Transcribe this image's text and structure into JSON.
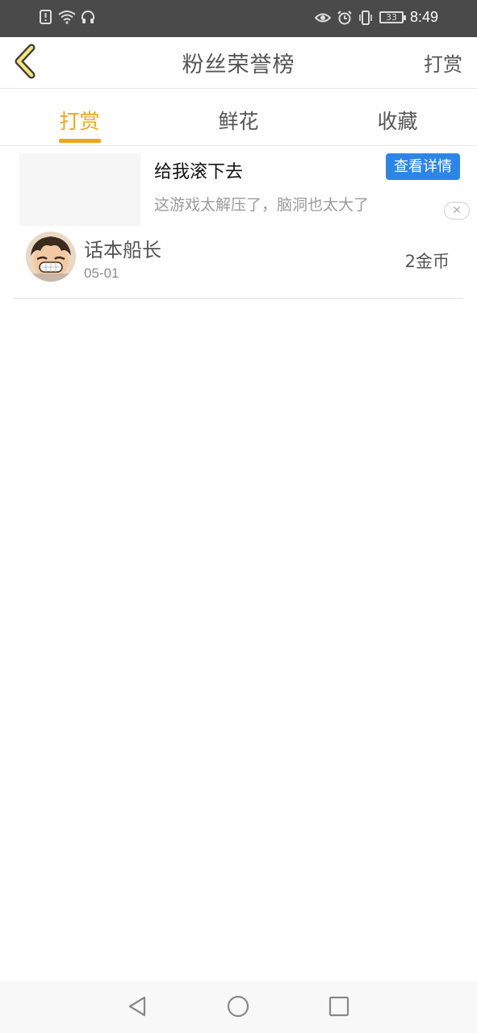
{
  "status_bar": {
    "time": "8:49",
    "battery": "33",
    "icons_left": [
      "alert-icon",
      "wifi-icon",
      "headphones-icon"
    ],
    "icons_right": [
      "eye-icon",
      "alarm-icon",
      "vibrate-icon",
      "battery-icon"
    ]
  },
  "header": {
    "title": "粉丝荣誉榜",
    "action_label": "打赏",
    "back_icon": "chevron-left-icon"
  },
  "tabs": [
    {
      "label": "打赏",
      "active": true
    },
    {
      "label": "鲜花",
      "active": false
    },
    {
      "label": "收藏",
      "active": false
    }
  ],
  "ad": {
    "title": "给我滚下去",
    "description": "这游戏太解压了，脑洞也太大了",
    "button_label": "查看详情",
    "close_icon": "close-icon"
  },
  "rank_list": [
    {
      "name": "话本船长",
      "date": "05-01",
      "reward": "2金币"
    }
  ],
  "colors": {
    "accent": "#f0a51e",
    "ad_button": "#2d86e6",
    "status_bar": "#4a4a4a"
  },
  "nav_bar": {
    "icons": [
      "back-triangle-icon",
      "home-circle-icon",
      "recents-square-icon"
    ]
  }
}
